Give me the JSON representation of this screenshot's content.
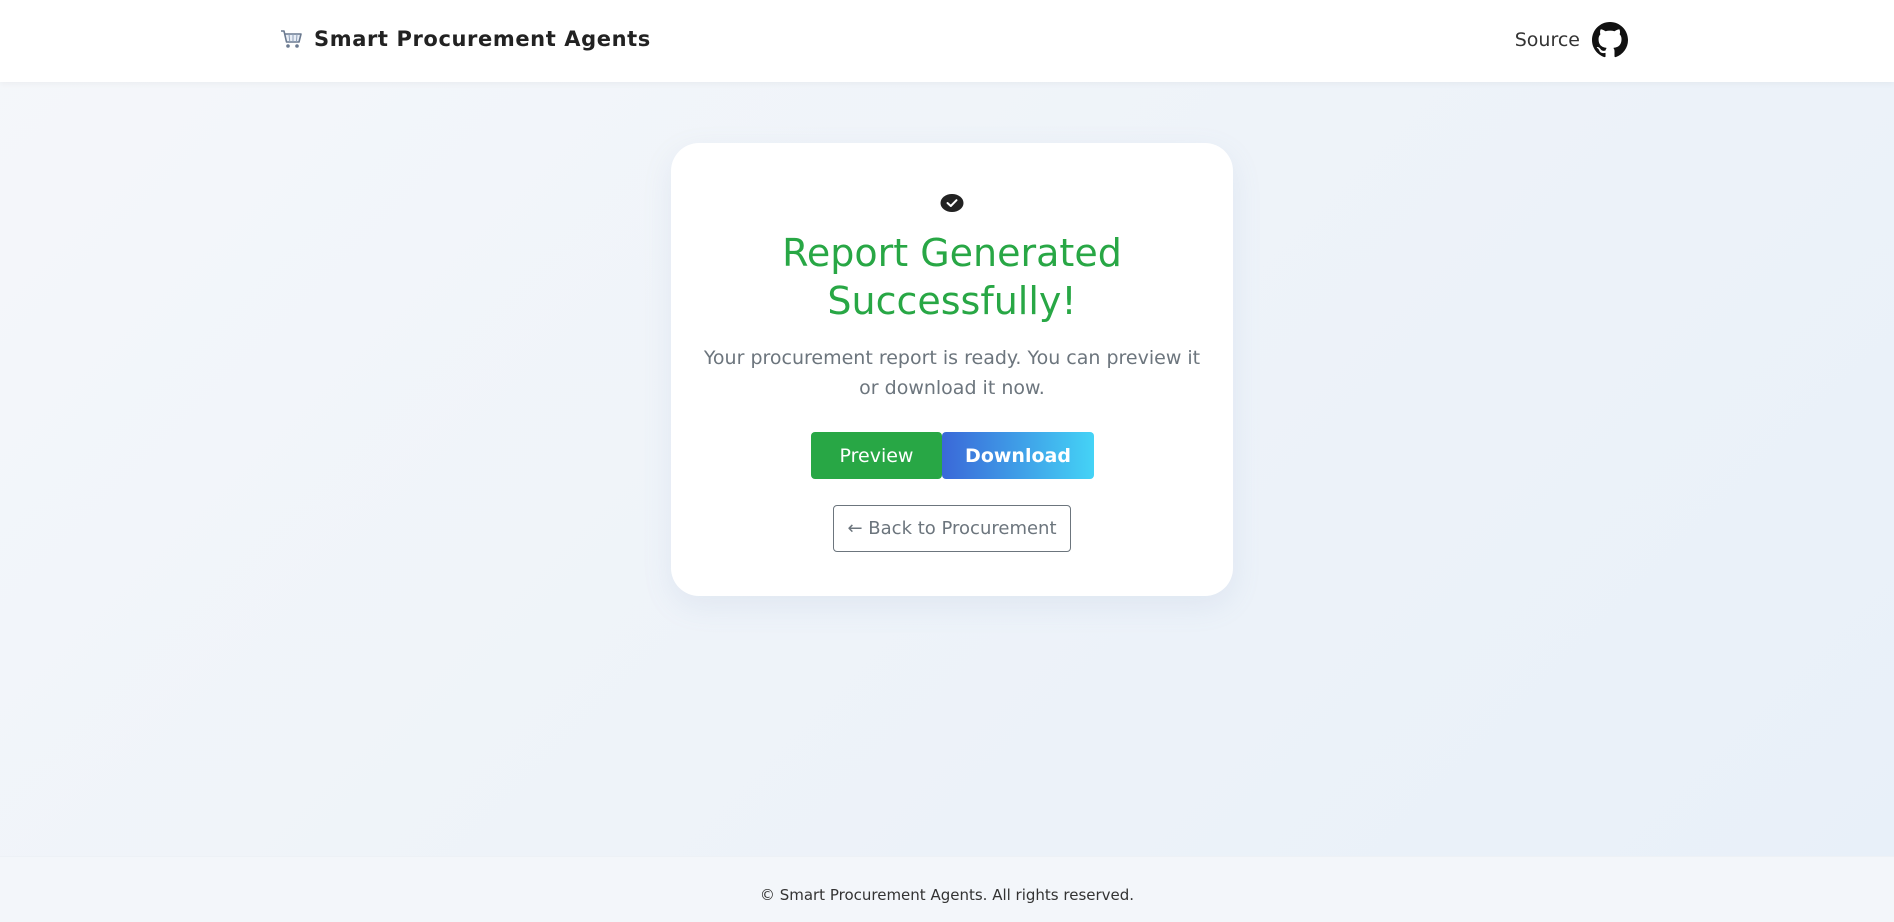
{
  "navbar": {
    "brand_icon": "shopping-cart-icon",
    "brand_title": "Smart Procurement Agents",
    "source_label": "Source",
    "source_icon": "github-icon"
  },
  "card": {
    "status_icon": "check-circle-icon",
    "title": "Report Generated Successfully!",
    "message": "Your procurement report is ready. You can preview it or download it now.",
    "preview_label": "Preview",
    "download_label": "Download",
    "back_label": "← Back to Procurement"
  },
  "footer": {
    "text": "© Smart Procurement Agents. All rights reserved."
  },
  "colors": {
    "success": "#28a745",
    "download_gradient_start": "#3a68d8",
    "download_gradient_end": "#44d3f6",
    "muted": "#6c757d"
  }
}
